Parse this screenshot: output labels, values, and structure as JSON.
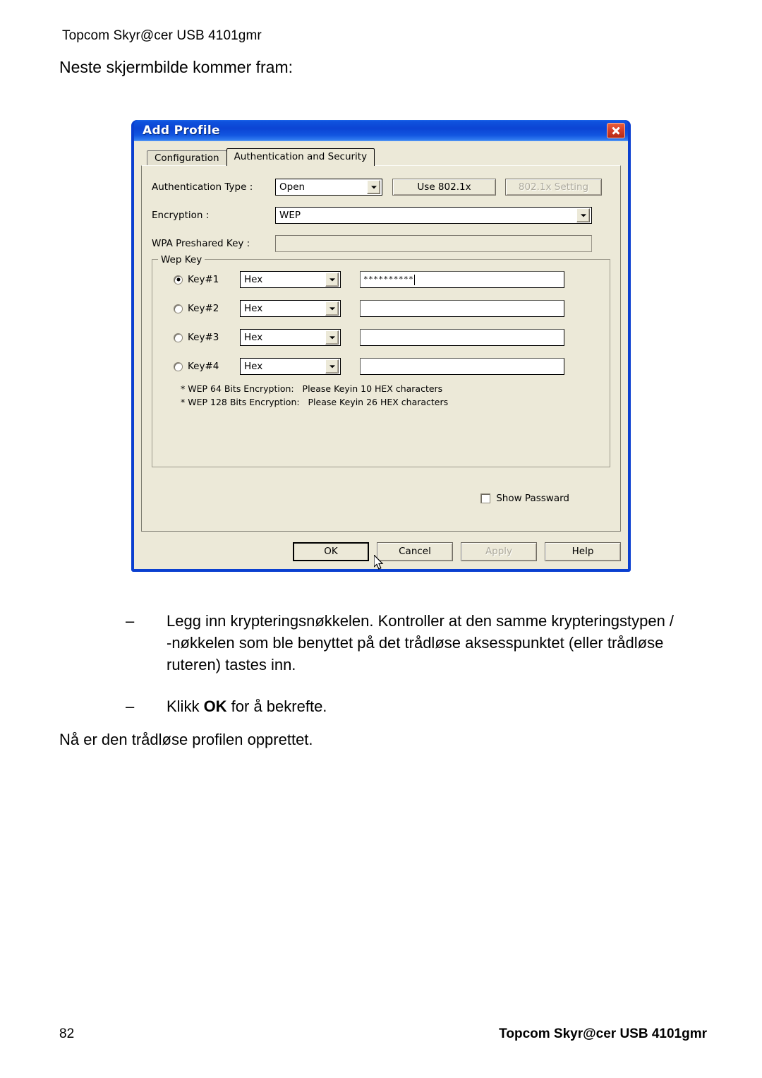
{
  "document": {
    "header": "Topcom Skyr@cer USB 4101gmr",
    "intro": "Neste skjermbilde kommer fram:",
    "bullets": [
      {
        "marker": "–",
        "text": "Legg inn krypteringsnøkkelen. Kontroller at den samme krypteringstypen / -nøkkelen som ble benyttet på det trådløse aksesspunktet (eller trådløse ruteren) tastes inn."
      },
      {
        "marker": "–",
        "text_before": "Klikk ",
        "text_bold": "OK",
        "text_after": " for å bekrefte."
      }
    ],
    "closing": "Nå er den trådløse profilen opprettet.",
    "footer": {
      "page_number": "82",
      "title": "Topcom Skyr@cer USB 4101gmr"
    }
  },
  "dialog": {
    "title": "Add Profile",
    "close_icon": "close-icon",
    "tabs": [
      {
        "label": "Configuration",
        "active": false
      },
      {
        "label": "Authentication and Security",
        "active": true
      }
    ],
    "fields": {
      "auth_type_label": "Authentication Type :",
      "auth_type_value": "Open",
      "use_8021x_label": "Use 802.1x",
      "setting_8021x_label": "802.1x Setting",
      "encryption_label": "Encryption :",
      "encryption_value": "WEP",
      "wpa_preshared_label": "WPA Preshared Key :",
      "wpa_preshared_value": ""
    },
    "wep_key": {
      "legend": "Wep Key",
      "keys": [
        {
          "label": "Key#1",
          "format": "Hex",
          "value": "**********",
          "selected": true
        },
        {
          "label": "Key#2",
          "format": "Hex",
          "value": "",
          "selected": false
        },
        {
          "label": "Key#3",
          "format": "Hex",
          "value": "",
          "selected": false
        },
        {
          "label": "Key#4",
          "format": "Hex",
          "value": "",
          "selected": false
        }
      ],
      "hints": [
        "* WEP 64 Bits Encryption:   Please Keyin 10 HEX characters",
        "* WEP 128 Bits Encryption:   Please Keyin 26 HEX characters"
      ]
    },
    "show_password": {
      "label": "Show Passward",
      "checked": false
    },
    "buttons": [
      {
        "label": "OK",
        "state": "default"
      },
      {
        "label": "Cancel",
        "state": "normal"
      },
      {
        "label": "Apply",
        "state": "disabled"
      },
      {
        "label": "Help",
        "state": "normal"
      }
    ],
    "colors": {
      "titlebar_blue": "#0b44d4",
      "face": "#ece9d8",
      "close_red": "#d6402a",
      "disabled_text": "#adaa9e"
    }
  }
}
